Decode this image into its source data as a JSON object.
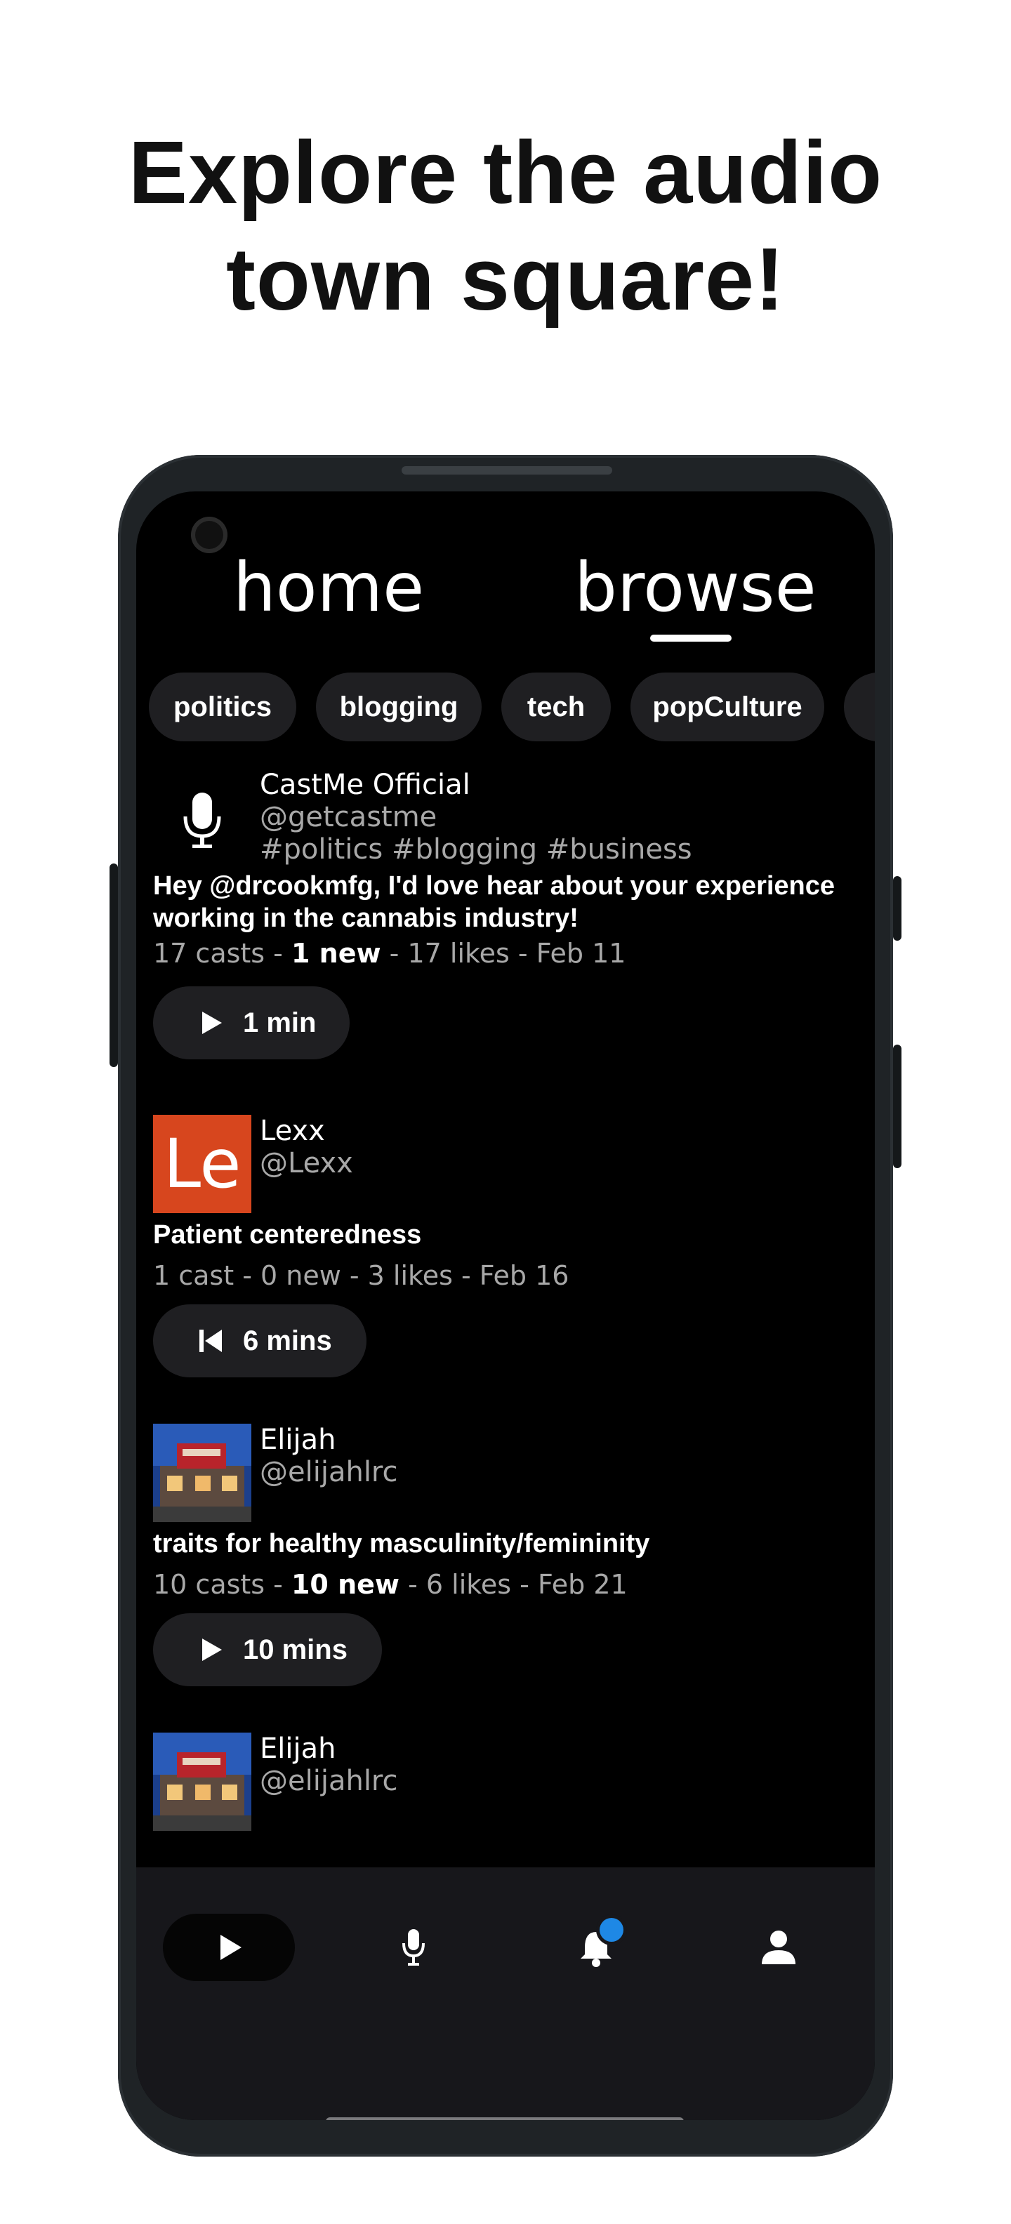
{
  "headline": {
    "line1": "Explore the audio",
    "line2": "town square!"
  },
  "top_tabs": {
    "home": "home",
    "browse": "browse",
    "active": "browse"
  },
  "chips": [
    "politics",
    "blogging",
    "tech",
    "popCulture"
  ],
  "posts": [
    {
      "name": "CastMe Official",
      "handle": "@getcastme",
      "tags": "#politics #blogging #business",
      "title": "Hey @drcookmfg, I'd love hear about your experience working in the cannabis industry!",
      "casts": "17 casts - ",
      "new": "1 new",
      "rest": " - 17 likes - Feb 11",
      "button_icon": "play-icon",
      "duration": "1 min"
    },
    {
      "name": "Lexx",
      "handle": "@Lexx",
      "avatar_initials": "Le",
      "avatar_color": "#d7461e",
      "title": "Patient centeredness",
      "meta": "1 cast - 0 new - 3 likes - Feb 16",
      "button_icon": "skip-previous-icon",
      "duration": "6 mins"
    },
    {
      "name": "Elijah",
      "handle": "@elijahlrc",
      "title": "traits for healthy masculinity/femininity",
      "casts": "10 casts - ",
      "new": "10 new",
      "rest": " - 6 likes - Feb 21",
      "button_icon": "play-icon",
      "duration": "10 mins"
    },
    {
      "name": "Elijah",
      "handle": "@elijahlrc"
    }
  ],
  "bottom_nav": [
    {
      "icon": "play-icon",
      "active": true
    },
    {
      "icon": "microphone-icon",
      "active": false
    },
    {
      "icon": "notification-bell-icon",
      "active": false,
      "badge": true,
      "badge_color": "#1e88e5"
    },
    {
      "icon": "profile-icon",
      "active": false
    }
  ]
}
